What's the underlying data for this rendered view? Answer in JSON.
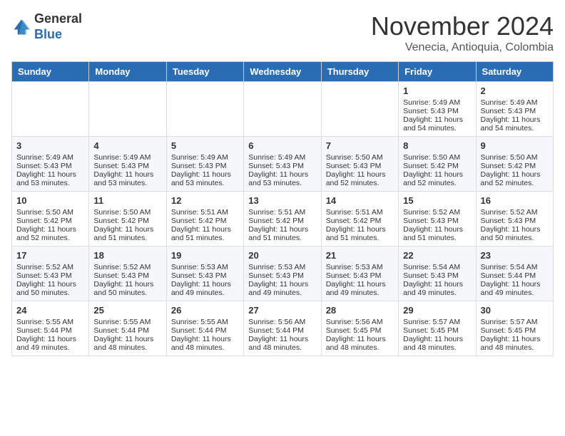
{
  "header": {
    "logo_general": "General",
    "logo_blue": "Blue",
    "month_title": "November 2024",
    "location": "Venecia, Antioquia, Colombia"
  },
  "weekdays": [
    "Sunday",
    "Monday",
    "Tuesday",
    "Wednesday",
    "Thursday",
    "Friday",
    "Saturday"
  ],
  "weeks": [
    [
      {
        "day": "",
        "sunrise": "",
        "sunset": "",
        "daylight": ""
      },
      {
        "day": "",
        "sunrise": "",
        "sunset": "",
        "daylight": ""
      },
      {
        "day": "",
        "sunrise": "",
        "sunset": "",
        "daylight": ""
      },
      {
        "day": "",
        "sunrise": "",
        "sunset": "",
        "daylight": ""
      },
      {
        "day": "",
        "sunrise": "",
        "sunset": "",
        "daylight": ""
      },
      {
        "day": "1",
        "sunrise": "Sunrise: 5:49 AM",
        "sunset": "Sunset: 5:43 PM",
        "daylight": "Daylight: 11 hours and 54 minutes."
      },
      {
        "day": "2",
        "sunrise": "Sunrise: 5:49 AM",
        "sunset": "Sunset: 5:43 PM",
        "daylight": "Daylight: 11 hours and 54 minutes."
      }
    ],
    [
      {
        "day": "3",
        "sunrise": "Sunrise: 5:49 AM",
        "sunset": "Sunset: 5:43 PM",
        "daylight": "Daylight: 11 hours and 53 minutes."
      },
      {
        "day": "4",
        "sunrise": "Sunrise: 5:49 AM",
        "sunset": "Sunset: 5:43 PM",
        "daylight": "Daylight: 11 hours and 53 minutes."
      },
      {
        "day": "5",
        "sunrise": "Sunrise: 5:49 AM",
        "sunset": "Sunset: 5:43 PM",
        "daylight": "Daylight: 11 hours and 53 minutes."
      },
      {
        "day": "6",
        "sunrise": "Sunrise: 5:49 AM",
        "sunset": "Sunset: 5:43 PM",
        "daylight": "Daylight: 11 hours and 53 minutes."
      },
      {
        "day": "7",
        "sunrise": "Sunrise: 5:50 AM",
        "sunset": "Sunset: 5:43 PM",
        "daylight": "Daylight: 11 hours and 52 minutes."
      },
      {
        "day": "8",
        "sunrise": "Sunrise: 5:50 AM",
        "sunset": "Sunset: 5:42 PM",
        "daylight": "Daylight: 11 hours and 52 minutes."
      },
      {
        "day": "9",
        "sunrise": "Sunrise: 5:50 AM",
        "sunset": "Sunset: 5:42 PM",
        "daylight": "Daylight: 11 hours and 52 minutes."
      }
    ],
    [
      {
        "day": "10",
        "sunrise": "Sunrise: 5:50 AM",
        "sunset": "Sunset: 5:42 PM",
        "daylight": "Daylight: 11 hours and 52 minutes."
      },
      {
        "day": "11",
        "sunrise": "Sunrise: 5:50 AM",
        "sunset": "Sunset: 5:42 PM",
        "daylight": "Daylight: 11 hours and 51 minutes."
      },
      {
        "day": "12",
        "sunrise": "Sunrise: 5:51 AM",
        "sunset": "Sunset: 5:42 PM",
        "daylight": "Daylight: 11 hours and 51 minutes."
      },
      {
        "day": "13",
        "sunrise": "Sunrise: 5:51 AM",
        "sunset": "Sunset: 5:42 PM",
        "daylight": "Daylight: 11 hours and 51 minutes."
      },
      {
        "day": "14",
        "sunrise": "Sunrise: 5:51 AM",
        "sunset": "Sunset: 5:42 PM",
        "daylight": "Daylight: 11 hours and 51 minutes."
      },
      {
        "day": "15",
        "sunrise": "Sunrise: 5:52 AM",
        "sunset": "Sunset: 5:43 PM",
        "daylight": "Daylight: 11 hours and 51 minutes."
      },
      {
        "day": "16",
        "sunrise": "Sunrise: 5:52 AM",
        "sunset": "Sunset: 5:43 PM",
        "daylight": "Daylight: 11 hours and 50 minutes."
      }
    ],
    [
      {
        "day": "17",
        "sunrise": "Sunrise: 5:52 AM",
        "sunset": "Sunset: 5:43 PM",
        "daylight": "Daylight: 11 hours and 50 minutes."
      },
      {
        "day": "18",
        "sunrise": "Sunrise: 5:52 AM",
        "sunset": "Sunset: 5:43 PM",
        "daylight": "Daylight: 11 hours and 50 minutes."
      },
      {
        "day": "19",
        "sunrise": "Sunrise: 5:53 AM",
        "sunset": "Sunset: 5:43 PM",
        "daylight": "Daylight: 11 hours and 49 minutes."
      },
      {
        "day": "20",
        "sunrise": "Sunrise: 5:53 AM",
        "sunset": "Sunset: 5:43 PM",
        "daylight": "Daylight: 11 hours and 49 minutes."
      },
      {
        "day": "21",
        "sunrise": "Sunrise: 5:53 AM",
        "sunset": "Sunset: 5:43 PM",
        "daylight": "Daylight: 11 hours and 49 minutes."
      },
      {
        "day": "22",
        "sunrise": "Sunrise: 5:54 AM",
        "sunset": "Sunset: 5:43 PM",
        "daylight": "Daylight: 11 hours and 49 minutes."
      },
      {
        "day": "23",
        "sunrise": "Sunrise: 5:54 AM",
        "sunset": "Sunset: 5:44 PM",
        "daylight": "Daylight: 11 hours and 49 minutes."
      }
    ],
    [
      {
        "day": "24",
        "sunrise": "Sunrise: 5:55 AM",
        "sunset": "Sunset: 5:44 PM",
        "daylight": "Daylight: 11 hours and 49 minutes."
      },
      {
        "day": "25",
        "sunrise": "Sunrise: 5:55 AM",
        "sunset": "Sunset: 5:44 PM",
        "daylight": "Daylight: 11 hours and 48 minutes."
      },
      {
        "day": "26",
        "sunrise": "Sunrise: 5:55 AM",
        "sunset": "Sunset: 5:44 PM",
        "daylight": "Daylight: 11 hours and 48 minutes."
      },
      {
        "day": "27",
        "sunrise": "Sunrise: 5:56 AM",
        "sunset": "Sunset: 5:44 PM",
        "daylight": "Daylight: 11 hours and 48 minutes."
      },
      {
        "day": "28",
        "sunrise": "Sunrise: 5:56 AM",
        "sunset": "Sunset: 5:45 PM",
        "daylight": "Daylight: 11 hours and 48 minutes."
      },
      {
        "day": "29",
        "sunrise": "Sunrise: 5:57 AM",
        "sunset": "Sunset: 5:45 PM",
        "daylight": "Daylight: 11 hours and 48 minutes."
      },
      {
        "day": "30",
        "sunrise": "Sunrise: 5:57 AM",
        "sunset": "Sunset: 5:45 PM",
        "daylight": "Daylight: 11 hours and 48 minutes."
      }
    ]
  ]
}
